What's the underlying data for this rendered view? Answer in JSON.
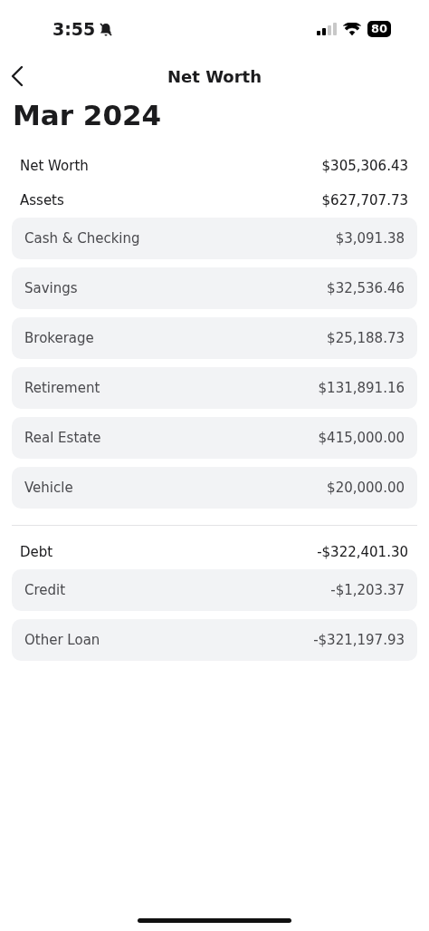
{
  "status_bar": {
    "time": "3:55",
    "battery": "80"
  },
  "nav": {
    "title": "Net Worth"
  },
  "heading": "Mar 2024",
  "net_worth": {
    "label": "Net Worth",
    "value": "$305,306.43"
  },
  "sections": [
    {
      "label": "Assets",
      "value": "$627,707.73",
      "items": [
        {
          "label": "Cash & Checking",
          "value": "$3,091.38"
        },
        {
          "label": "Savings",
          "value": "$32,536.46"
        },
        {
          "label": "Brokerage",
          "value": "$25,188.73"
        },
        {
          "label": "Retirement",
          "value": "$131,891.16"
        },
        {
          "label": "Real Estate",
          "value": "$415,000.00"
        },
        {
          "label": "Vehicle",
          "value": "$20,000.00"
        }
      ]
    },
    {
      "label": "Debt",
      "value": "-$322,401.30",
      "items": [
        {
          "label": "Credit",
          "value": "-$1,203.37"
        },
        {
          "label": "Other Loan",
          "value": "-$321,197.93"
        }
      ]
    }
  ]
}
